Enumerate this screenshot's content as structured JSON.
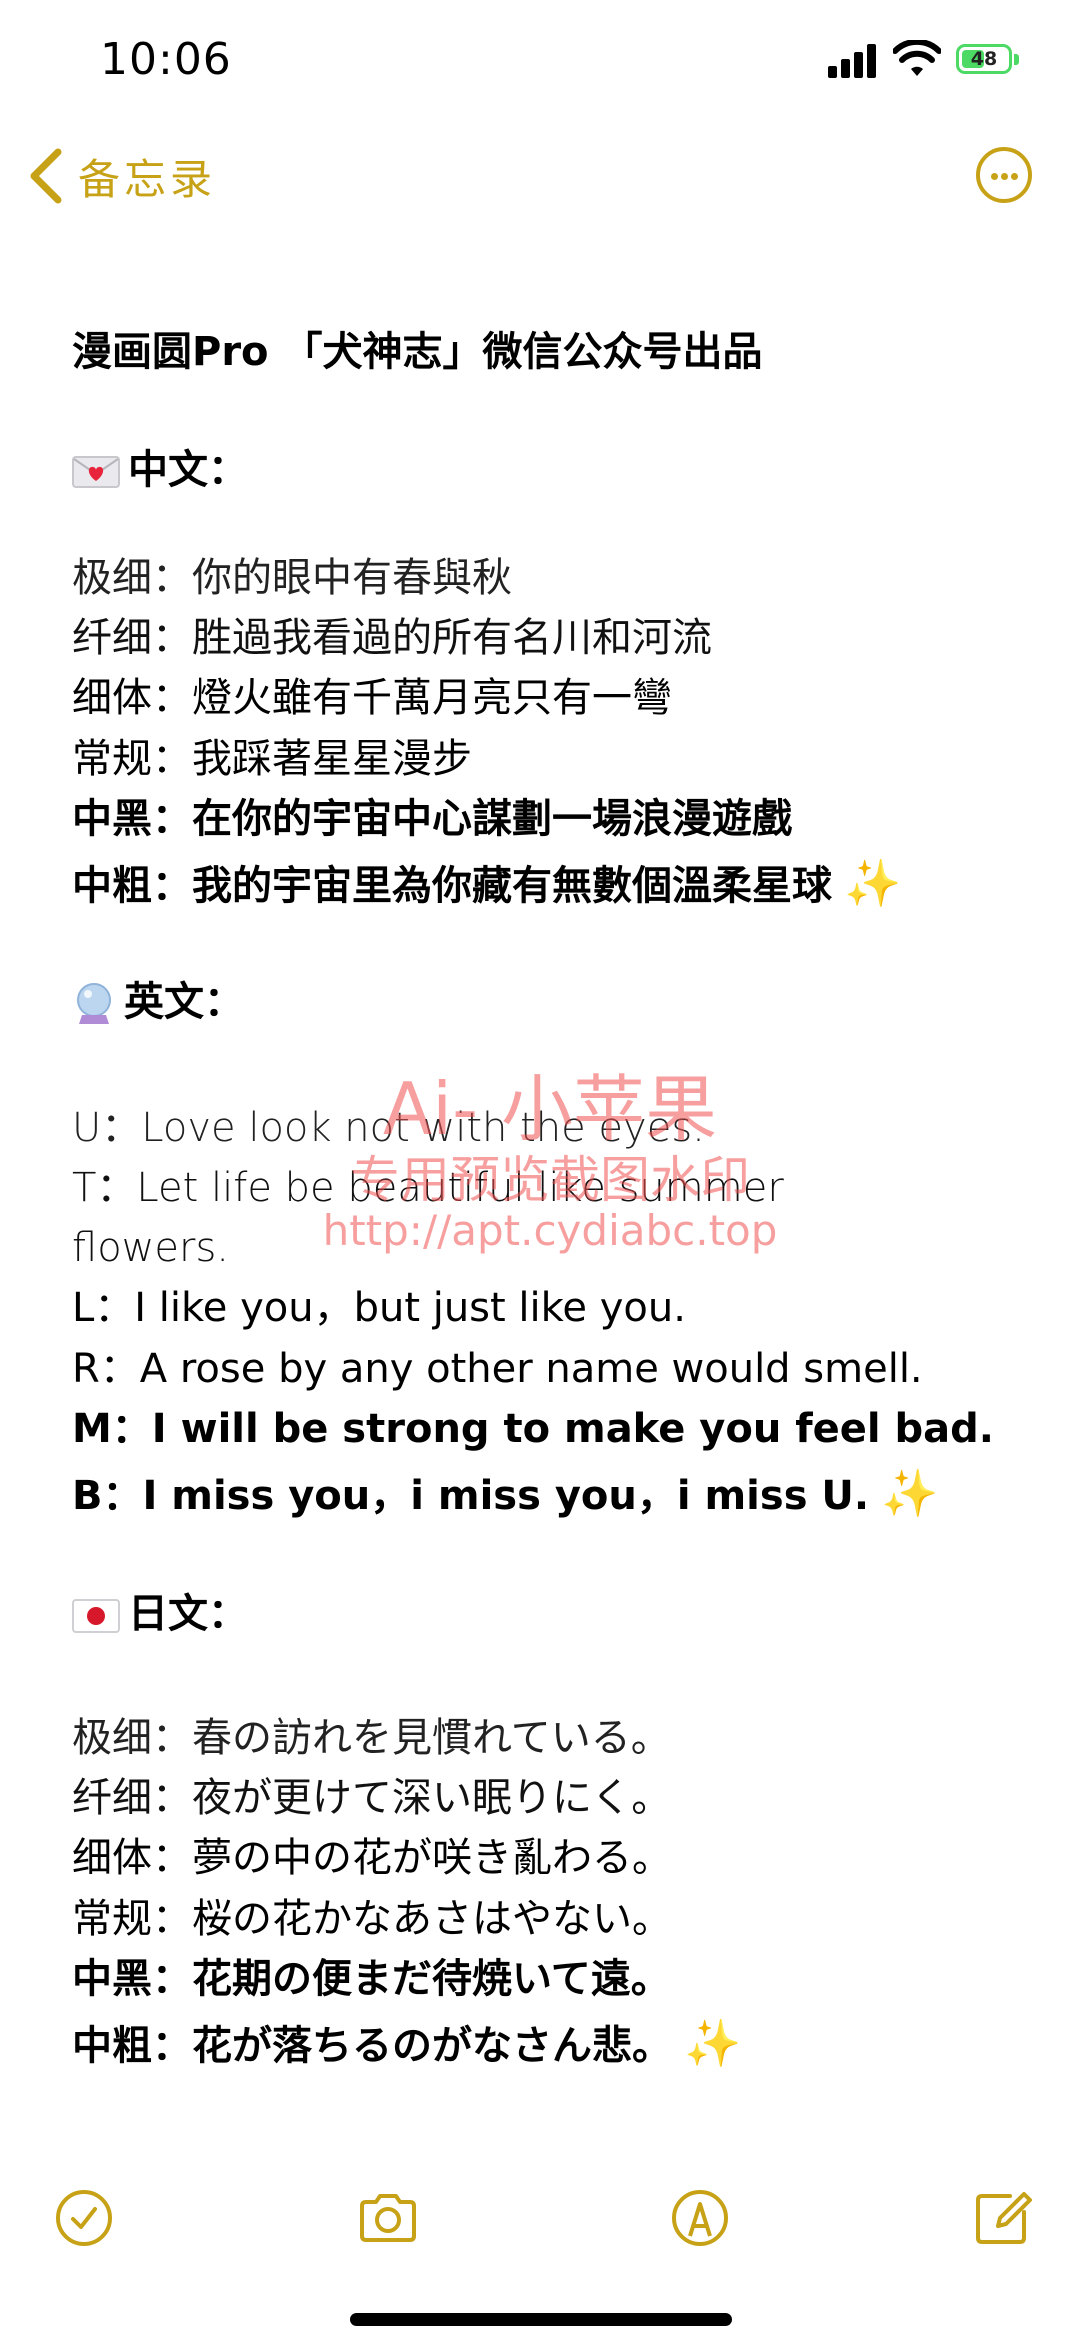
{
  "status_bar": {
    "time": "10:06",
    "battery_percent": "48"
  },
  "nav": {
    "back_label": "备忘录"
  },
  "note": {
    "title": "漫画圆Pro 「犬神志」微信公众号出品",
    "sections": [
      {
        "icon": "love-letter-icon",
        "heading": "中文：",
        "lines": [
          {
            "text": "极细：你的眼中有春與秋",
            "weight": "w1"
          },
          {
            "text": "纤细：胜過我看過的所有名川和河流",
            "weight": "w2"
          },
          {
            "text": "细体：燈火雖有千萬月亮只有一彎",
            "weight": "w3"
          },
          {
            "text": "常规：我踩著星星漫步",
            "weight": "w4"
          },
          {
            "text": "中黑：在你的宇宙中心謀劃一場浪漫遊戲",
            "weight": "w5"
          },
          {
            "text": "中粗：我的宇宙里為你藏有無數個溫柔星球",
            "weight": "w6",
            "sparkle": "✨"
          }
        ]
      },
      {
        "icon": "crystal-ball-icon",
        "heading": "英文：",
        "lines": [
          {
            "text": "U：Love look not with the eyes.",
            "weight": "w1"
          },
          {
            "text": "T：Let life be beautiful like summer",
            "weight": "w2"
          },
          {
            "text": "flowers.",
            "weight": "w2"
          },
          {
            "text": "L：I like you，but just like you.",
            "weight": "w3"
          },
          {
            "text": "R：A rose by any other name would smell.",
            "weight": "w4"
          },
          {
            "text": "M：I will be strong to make you feel bad.",
            "weight": "w5"
          },
          {
            "text": "B：I miss you，i miss you，i miss U.",
            "weight": "w6",
            "sparkle": "✨"
          }
        ]
      },
      {
        "icon": "japan-flag-icon",
        "heading": "日文：",
        "lines": [
          {
            "text": "极细：春の訪れを見慣れている。",
            "weight": "w1"
          },
          {
            "text": "纤细：夜が更けて深い眠りにく。",
            "weight": "w2"
          },
          {
            "text": "细体：夢の中の花が咲き亂わる。",
            "weight": "w3"
          },
          {
            "text": "常规：桜の花かなあさはやない。",
            "weight": "w4"
          },
          {
            "text": "中黑：花期の便まだ待焼いて遠。",
            "weight": "w5"
          },
          {
            "text": "中粗：花が落ちるのがなさん悲。",
            "weight": "w6",
            "sparkle": "✨"
          }
        ]
      }
    ]
  },
  "watermark": {
    "line1": "Ai- 小苹果",
    "line2": "专用预览截图水印",
    "line3": "http://apt.cydiabc.top"
  },
  "colors": {
    "accent": "#c7a217",
    "battery": "#4cd964",
    "watermark": "#f05050"
  }
}
